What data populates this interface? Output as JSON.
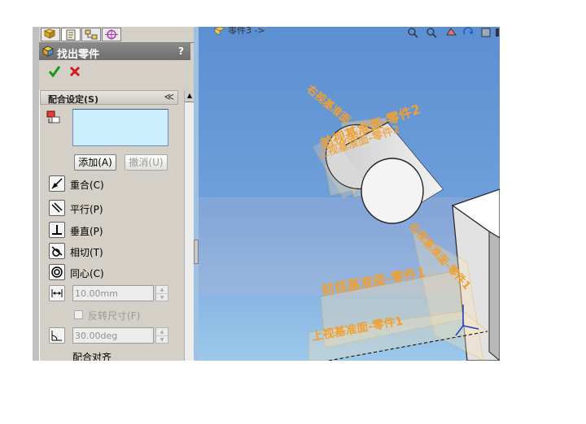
{
  "property_manager": {
    "title": "找出零件",
    "help": "?",
    "group_title": "配合设定(S)",
    "group_collapse": "≪",
    "buttons": {
      "add": "添加(A)",
      "undo": "撤消(U)"
    },
    "mates": [
      {
        "label": "重合(C)",
        "enabled": true
      },
      {
        "label": "平行(P)",
        "enabled": true
      },
      {
        "label": "垂直(P)",
        "enabled": true
      },
      {
        "label": "相切(T)",
        "enabled": true
      },
      {
        "label": "同心(C)",
        "enabled": true
      }
    ],
    "distance_value": "10.00mm",
    "flip_dimension_label": "反转尺寸(F)",
    "angle_value": "30.00deg",
    "mate_alignment_label": "配合对齐"
  },
  "viewport": {
    "breadcrumb": "零件3 ->",
    "plane_labels": {
      "right_plane_part2": "右视基准面",
      "front_plane_part2": "前视基准面-零件2",
      "top_plane_part2": "上视基准面-零件2",
      "right_plane_part1": "右视基准面-零件1",
      "front_plane_part1": "前视基准面-零件1",
      "top_plane_part1": "上视基准面-零件1"
    },
    "colors": {
      "background_top": "#5c8fd2",
      "background_bottom": "#9bc8ea",
      "plane_label": "#f0a030"
    }
  },
  "icons": {
    "tabs": [
      "feature-manager-icon",
      "property-manager-icon",
      "configuration-manager-icon",
      "dimxpert-icon"
    ],
    "toolbar": [
      "zoom-fit-icon",
      "zoom-area-icon",
      "section-view-icon",
      "rotate-view-icon",
      "display-style-icon"
    ]
  }
}
